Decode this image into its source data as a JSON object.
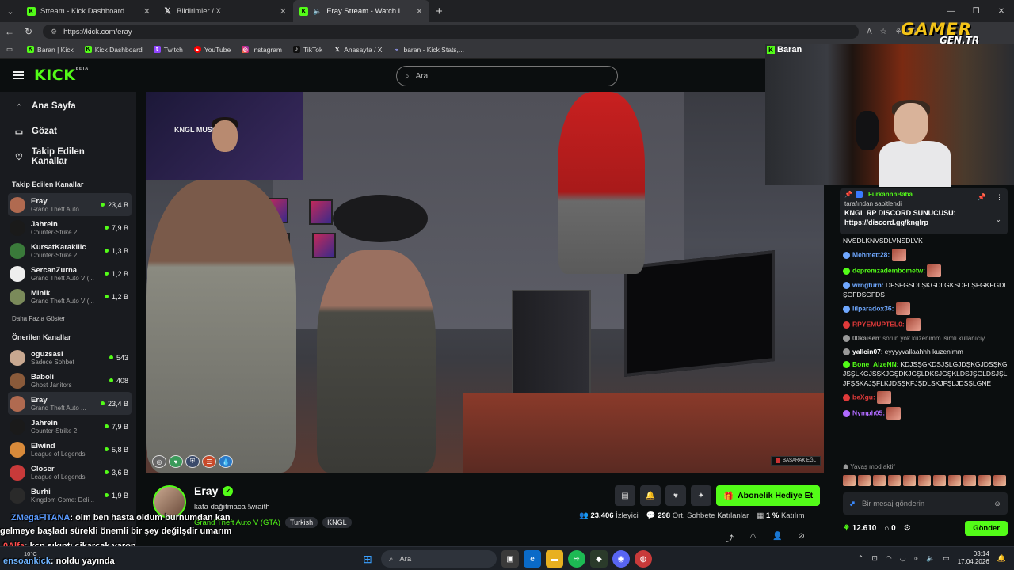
{
  "browser": {
    "tabs": [
      {
        "label": "Stream - Kick Dashboard",
        "icon": "kick"
      },
      {
        "label": "Bildirimler / X",
        "icon": "x"
      },
      {
        "label": "Eray Stream - Watch Live on K",
        "icon": "kick"
      }
    ],
    "url": "https://kick.com/eray",
    "bookmarks": [
      {
        "label": "Baran | Kick",
        "icon": "k"
      },
      {
        "label": "Kick Dashboard",
        "icon": "k"
      },
      {
        "label": "Twitch",
        "icon": "tw"
      },
      {
        "label": "YouTube",
        "icon": "yt"
      },
      {
        "label": "Instagram",
        "icon": "ig"
      },
      {
        "label": "TikTok",
        "icon": "tt"
      },
      {
        "label": "Anasayfa / X",
        "icon": "xx"
      },
      {
        "label": "baran - Kick Stats,...",
        "icon": "bs"
      }
    ]
  },
  "header": {
    "logo": "KICK",
    "logo_sup": "BETA",
    "search_placeholder": "Ara"
  },
  "sidebar": {
    "nav": [
      {
        "label": "Ana Sayfa",
        "icon": "home-icon"
      },
      {
        "label": "Gözat",
        "icon": "compass-icon"
      },
      {
        "label": "Takip Edilen Kanallar",
        "icon": "heart-icon"
      }
    ],
    "followed_title": "Takip Edilen Kanallar",
    "followed": [
      {
        "name": "Eray",
        "game": "Grand Theft Auto ...",
        "viewers": "23,4 B",
        "color": "#b06a50",
        "active": true
      },
      {
        "name": "Jahrein",
        "game": "Counter-Strike 2",
        "viewers": "7,9 B",
        "color": "#1a1a1a"
      },
      {
        "name": "KursatKarakilic",
        "game": "Counter-Strike 2",
        "viewers": "1,3 B",
        "color": "#3a7a3a"
      },
      {
        "name": "SercanZurna",
        "game": "Grand Theft Auto V (...",
        "viewers": "1,2 B",
        "color": "#eeeeee"
      },
      {
        "name": "Minik",
        "game": "Grand Theft Auto V (...",
        "viewers": "1,2 B",
        "color": "#7a8a5a"
      }
    ],
    "more_label": "Daha Fazla Göster",
    "recommended_title": "Önerilen Kanallar",
    "recommended": [
      {
        "name": "oguzsasi",
        "game": "Sadece Sohbet",
        "viewers": "543",
        "color": "#c8a890"
      },
      {
        "name": "Baboli",
        "game": "Ghost Janitors",
        "viewers": "408",
        "color": "#8a5a3a"
      },
      {
        "name": "Eray",
        "game": "Grand Theft Auto ...",
        "viewers": "23,4 B",
        "color": "#b06a50",
        "active": true
      },
      {
        "name": "Jahrein",
        "game": "Counter-Strike 2",
        "viewers": "7,9 B",
        "color": "#1a1a1a"
      },
      {
        "name": "Elwind",
        "game": "League of Legends",
        "viewers": "5,8 B",
        "color": "#d88a3a"
      },
      {
        "name": "Closer",
        "game": "League of Legends",
        "viewers": "3,6 B",
        "color": "#c83a3a"
      },
      {
        "name": "Burhi",
        "game": "Kingdom Come: Deli...",
        "viewers": "1,9 B",
        "color": "#2a2a2a"
      }
    ]
  },
  "webcam": {
    "channel_label": "Baran",
    "watermark_top": "GAMER",
    "watermark_bottom": "GEN.TR"
  },
  "video": {
    "inset_text": "KNGL MUSIC",
    "badge": "BASARAK EĞL"
  },
  "channel": {
    "name": "Eray",
    "title": "kafa dağıtmaca !wraith",
    "category": "Grand Theft Auto V (GTA)",
    "tags": [
      "Turkish",
      "KNGL"
    ],
    "gift_label": "Abonelik Hediye Et",
    "viewers": "23,406",
    "viewers_label": "İzleyici",
    "chatters": "298",
    "chatters_label": "Ort. Sohbete Katılanlar",
    "participation": "1 %",
    "participation_label": "Katılım"
  },
  "overlay_chat": [
    {
      "user": "ZMegaFiTANA",
      "text": ": olm ben hasta oldum burnumdan kan"
    },
    {
      "user": "",
      "text": "gelmeye başladı sürekli önemli bir şey değilşdir umarım"
    },
    {
      "user": "0Alfa",
      "text": ": kcp sıkıntı cikarcak yaron"
    },
    {
      "user": "ensoankick",
      "text": ": noldu yayında"
    }
  ],
  "chat": {
    "pinned_user": "FurkannnBaba",
    "pinned_by": "tarafından sabitlendi",
    "pinned_msg": "KNGL RP DISCORD SUNUCUSU:",
    "pinned_link": "https://discord.gg/knglrp",
    "messages": [
      {
        "user": "",
        "color": "#ffffff",
        "text": "NVSDLKNVSDLVNSDLVK",
        "emote": false
      },
      {
        "user": "Mehmett28",
        "color": "#6fa8ff",
        "text": "",
        "emote": true
      },
      {
        "user": "depremzadembometw",
        "color": "#53fc18",
        "text": "",
        "emote": true
      },
      {
        "user": "wrngturn",
        "color": "#6fa8ff",
        "text": "DFSFGSDLŞKGDLGKSDFLŞFGKFGDLŞGFDSGFDS",
        "emote": false
      },
      {
        "user": "lilparadox36",
        "color": "#6fa8ff",
        "text": "",
        "emote": true
      },
      {
        "user": "RPYEMUPTEL0",
        "color": "#e03a3a",
        "text": "",
        "emote": true
      },
      {
        "user": "00kaisen",
        "color": "#999999",
        "text": ": sorun yok kuzenimm isimli kullanıcıy...",
        "emote": false,
        "sys": true
      },
      {
        "user": "yallcin07",
        "color": "#ffffff",
        "text": ": eyyyyvallaahhh kuzenimm",
        "emote": false
      },
      {
        "user": "Bone_AizeNN",
        "color": "#53fc18",
        "text": ": KDJSŞGKDSJŞLGJDŞKGJDSŞKGJSŞLKGJSŞKJGŞDKJGŞLDKSJGŞKLDSJŞGLDSJŞLJFŞSKAJŞFLKJDSŞKFJŞDLSKJFŞLJDSŞLGNE",
        "emote": false
      },
      {
        "user": "beXgu",
        "color": "#e03a3a",
        "text": "",
        "emote": true
      },
      {
        "user": "Nymph05",
        "color": "#b06aff",
        "text": "",
        "emote": true
      }
    ],
    "slow_mode": "Yavaş mod aktif",
    "input_placeholder": "Bir mesaj gönderin",
    "points": "12.610",
    "boxes": "0",
    "send_label": "Gönder"
  },
  "taskbar": {
    "search_placeholder": "Ara",
    "weather": "10°C",
    "time": "03:14",
    "date": "17.04.2026"
  }
}
